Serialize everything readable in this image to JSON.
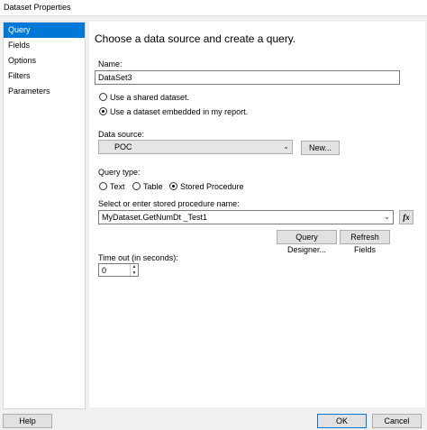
{
  "window": {
    "title": "Dataset Properties"
  },
  "sidebar": {
    "items": [
      {
        "label": "Query",
        "active": true
      },
      {
        "label": "Fields"
      },
      {
        "label": "Options"
      },
      {
        "label": "Filters"
      },
      {
        "label": "Parameters"
      }
    ]
  },
  "main": {
    "heading": "Choose a data source and create a query.",
    "name_label": "Name:",
    "name_value": "DataSet3",
    "shared_dataset_label": "Use a shared dataset.",
    "embedded_dataset_label": "Use a dataset embedded in my report.",
    "datasource_label": "Data source:",
    "datasource_value": "POC",
    "new_button": "New...",
    "query_type_label": "Query type:",
    "query_types": [
      "Text",
      "Table",
      "Stored Procedure"
    ],
    "sp_label": "Select or enter stored procedure name:",
    "sp_value": "MyDataset.GetNumDt _Test1",
    "fx_label": "fx",
    "query_designer_button": "Query Designer...",
    "refresh_fields_button": "Refresh Fields",
    "timeout_label": "Time out (in seconds):",
    "timeout_value": "0"
  },
  "footer": {
    "help": "Help",
    "ok": "OK",
    "cancel": "Cancel"
  },
  "colors": {
    "accent": "#0078d7"
  }
}
